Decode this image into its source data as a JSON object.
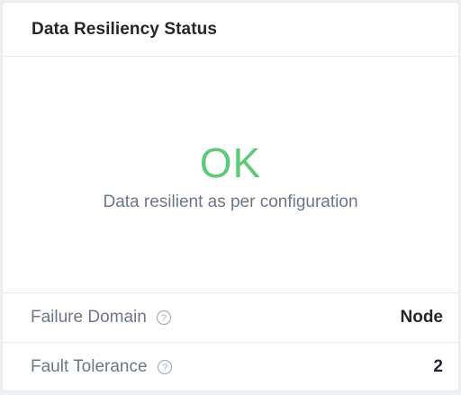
{
  "card": {
    "title": "Data Resiliency Status"
  },
  "status": {
    "value": "OK",
    "description": "Data resilient as per configuration",
    "color": "#5fc97a"
  },
  "rows": [
    {
      "label": "Failure Domain",
      "value": "Node",
      "icon": "help-circle-icon"
    },
    {
      "label": "Fault Tolerance",
      "value": "2",
      "icon": "help-circle-icon"
    }
  ]
}
